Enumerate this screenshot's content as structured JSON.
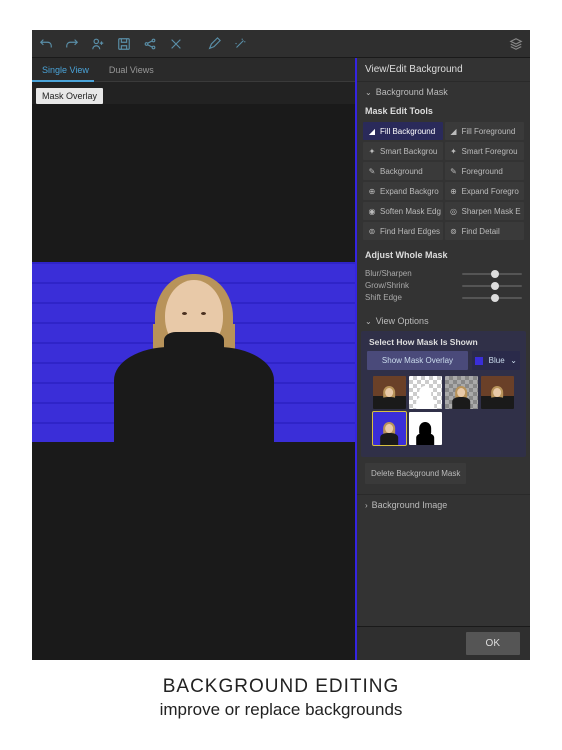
{
  "toolbar": {
    "icons": [
      "undo-icon",
      "redo-icon",
      "person-add-icon",
      "save-icon",
      "share-icon",
      "crop-icon",
      "brush-icon",
      "wand-icon",
      "layers-icon"
    ]
  },
  "view_tabs": {
    "single": "Single View",
    "dual": "Dual Views"
  },
  "overlay_tag": "Mask Overlay",
  "panel": {
    "title": "View/Edit Background",
    "section_mask": "Background Mask",
    "tools_title": "Mask Edit Tools",
    "tools": [
      {
        "label": "Fill Background",
        "icon": "bucket-icon",
        "active": true
      },
      {
        "label": "Fill Foreground",
        "icon": "bucket-icon"
      },
      {
        "label": "Smart Backgrou",
        "icon": "wand-icon"
      },
      {
        "label": "Smart Foregrou",
        "icon": "wand-icon"
      },
      {
        "label": "Background",
        "icon": "brush-icon"
      },
      {
        "label": "Foreground",
        "icon": "brush-icon"
      },
      {
        "label": "Expand Backgro",
        "icon": "expand-icon"
      },
      {
        "label": "Expand Foregro",
        "icon": "expand-icon"
      },
      {
        "label": "Soften Mask Edg",
        "icon": "soften-icon"
      },
      {
        "label": "Sharpen Mask E",
        "icon": "sharpen-icon"
      },
      {
        "label": "Find Hard Edges",
        "icon": "find-icon"
      },
      {
        "label": "Find Detail",
        "icon": "find-icon"
      }
    ],
    "adjust_title": "Adjust Whole Mask",
    "sliders": [
      {
        "label": "Blur/Sharpen",
        "pos": 50
      },
      {
        "label": "Grow/Shrink",
        "pos": 50
      },
      {
        "label": "Shift Edge",
        "pos": 50
      }
    ],
    "view_options": "View Options",
    "select_shown_title": "Select How Mask Is Shown",
    "show_overlay_btn": "Show Mask Overlay",
    "color_dd": "Blue",
    "delete_btn": "Delete Background Mask",
    "bg_image_section": "Background Image",
    "ok": "OK"
  },
  "caption": {
    "title": "BACKGROUND EDITING",
    "sub": "improve or replace backgrounds"
  }
}
